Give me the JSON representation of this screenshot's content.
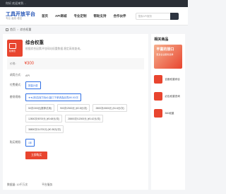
{
  "topbar": {
    "text": "你好,欢迎来到…"
  },
  "header": {
    "logo_title": "工具开放平台",
    "logo_sub": "专业·高效·稳定",
    "nav": [
      "首页",
      "API商城",
      "专业定制",
      "帮助支持",
      "合作伙伴"
    ],
    "search_placeholder": "搜索API服务"
  },
  "breadcrumb": {
    "home": "首页",
    "current": "综合权重"
  },
  "product": {
    "image_label": "权重查",
    "title": "综合权重",
    "desc": "根据综合因素评估网站权重数据,稳定高效查询。",
    "price_label": "价格:",
    "price": "¥300",
    "method_label": "调用方式:",
    "method_value": "API",
    "paytype_label": "付费模式:",
    "paytype_value": "按量计费",
    "package_label": "套餐规格:",
    "packages": [
      "★★(测试)官方标价(接口下单请选此项)¥0.00/次",
      "50次/300元(推荐试用)",
      "900次/2500元 (¥2.8元/次)",
      "2800次/4500元 (¥1.6元/次)",
      "12800次/8700元 (¥0.68元/次)",
      "28800次/12000元 (¥0.42元/次)",
      "38800次/14700元 (¥0.38元/次)"
    ],
    "period_label": "购买期限:",
    "period_value": "1年",
    "buy_label": "立即购买"
  },
  "bottom": {
    "left": "数据量: 10千万次",
    "right": "平台服务"
  },
  "side": {
    "title": "相关商品",
    "ad_title": "丰富的接口",
    "ad_sub": "更多企业服务选择",
    "recs": [
      "百度权重综合",
      "必应权重查询",
      "360权重"
    ]
  }
}
